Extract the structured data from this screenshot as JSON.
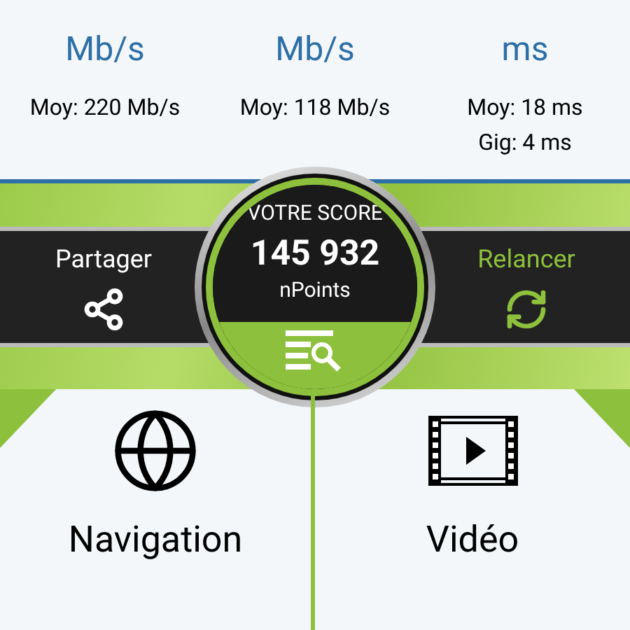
{
  "stats": [
    {
      "unit": "Mb/s",
      "notes": [
        "Moy: 220 Mb/s"
      ]
    },
    {
      "unit": "Mb/s",
      "notes": [
        "Moy: 118 Mb/s"
      ]
    },
    {
      "unit": "ms",
      "notes": [
        "Moy: 18 ms",
        "Gig: 4 ms"
      ]
    }
  ],
  "actions": [
    {
      "label": "Partager",
      "kind": "share"
    },
    {
      "label": "Relancer",
      "kind": "restart"
    }
  ],
  "score": {
    "title": "VOTRE SCORE",
    "value": "145 932",
    "unit": "nPoints"
  },
  "categories": [
    {
      "label": "Navigation",
      "kind": "web"
    },
    {
      "label": "Vidéo",
      "kind": "video"
    }
  ]
}
